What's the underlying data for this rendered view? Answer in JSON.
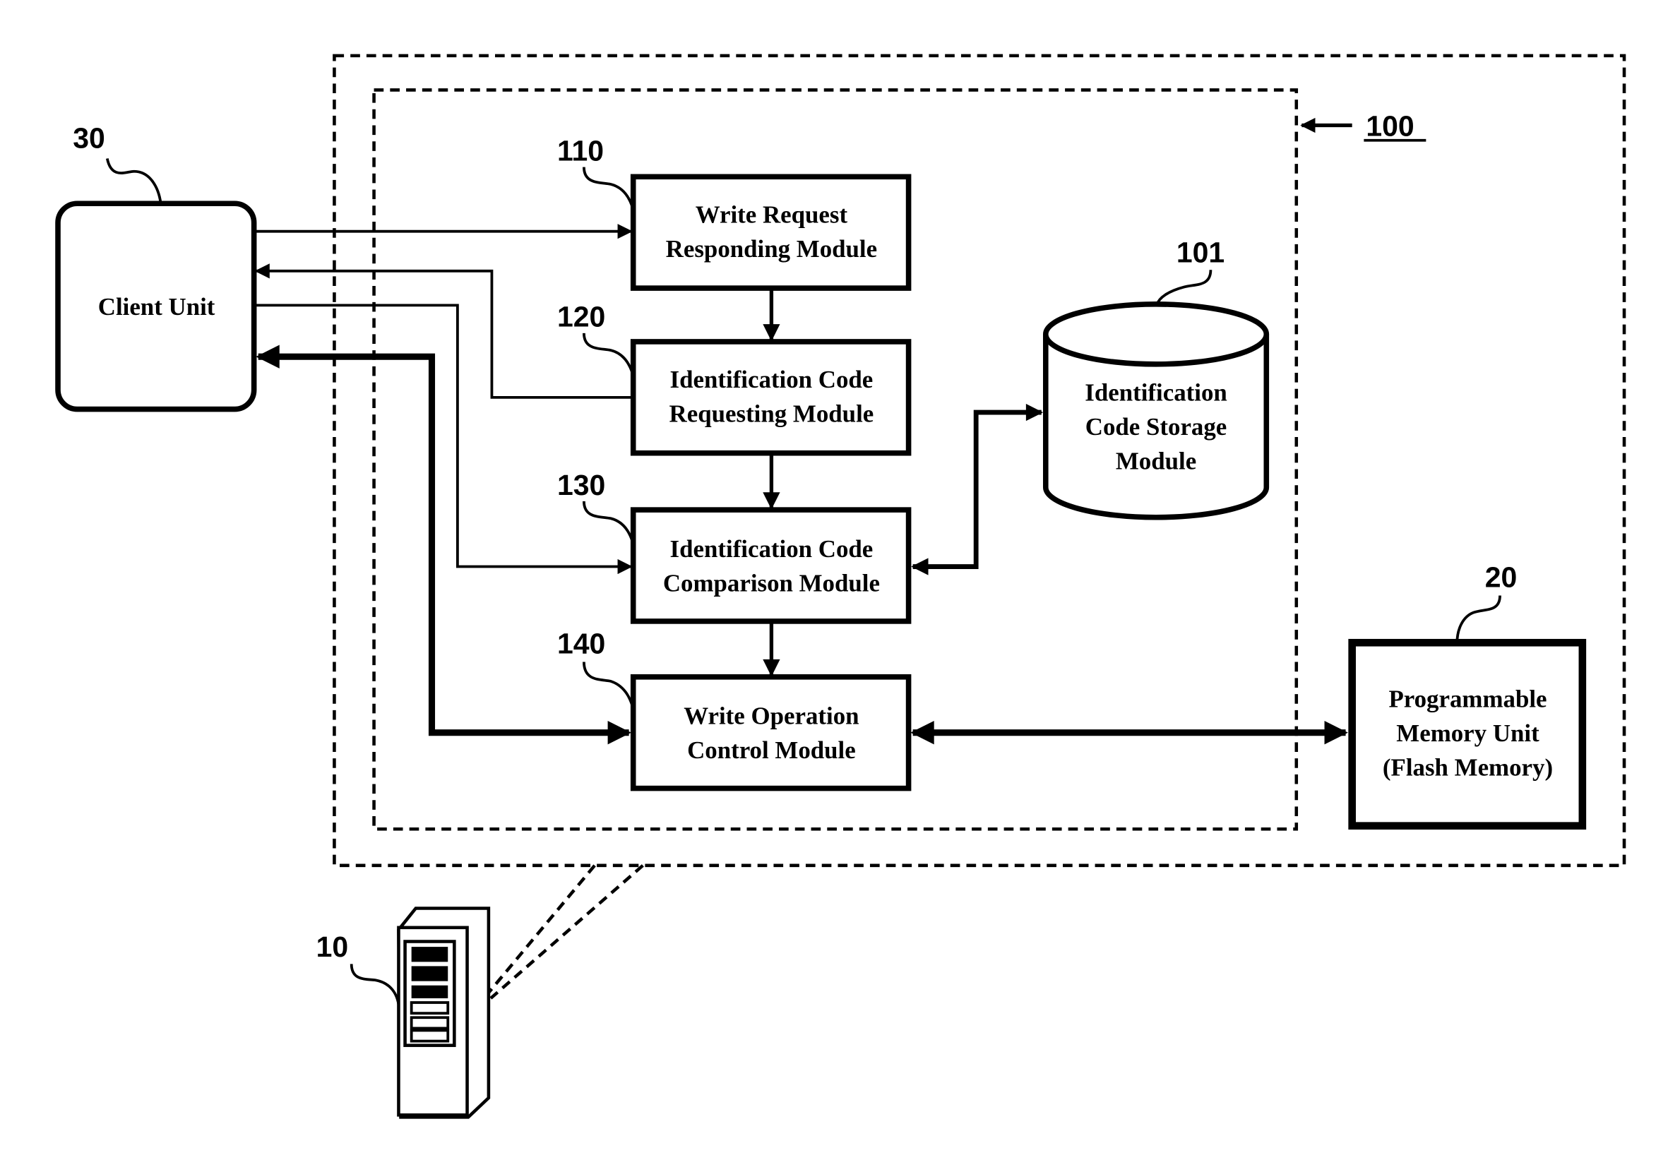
{
  "figure": {
    "system_ref": "100",
    "blocks": {
      "client_unit": {
        "ref": "30",
        "lines": [
          "Client Unit"
        ]
      },
      "write_request": {
        "ref": "110",
        "lines": [
          "Write Request",
          "Responding Module"
        ]
      },
      "id_requesting": {
        "ref": "120",
        "lines": [
          "Identification Code",
          "Requesting Module"
        ]
      },
      "id_comparison": {
        "ref": "130",
        "lines": [
          "Identification Code",
          "Comparison Module"
        ]
      },
      "write_control": {
        "ref": "140",
        "lines": [
          "Write Operation",
          "Control Module"
        ]
      },
      "id_storage": {
        "ref": "101",
        "lines": [
          "Identification",
          "Code Storage",
          "Module"
        ]
      },
      "memory_unit": {
        "ref": "20",
        "lines": [
          "Programmable",
          "Memory Unit",
          "(Flash Memory)"
        ]
      },
      "server": {
        "ref": "10",
        "icon": "server-tower-icon"
      }
    }
  }
}
